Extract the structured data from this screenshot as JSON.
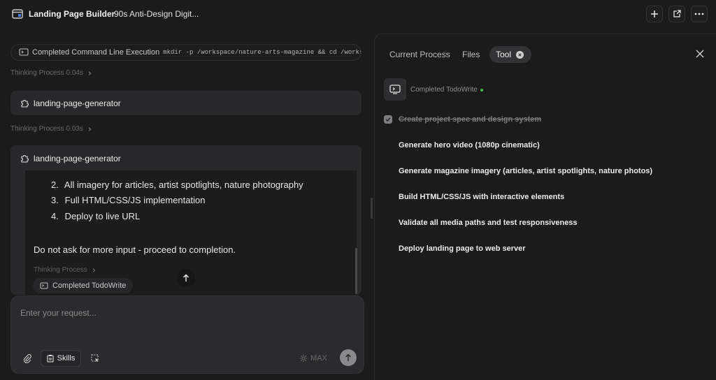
{
  "header": {
    "app_title": "Landing Page Builder",
    "doc_title": "90s Anti-Design Digit..."
  },
  "left": {
    "command_pill": {
      "label": "Completed Command Line Execution",
      "command": "mkdir -p /workspace/nature-arts-magazine && cd /workspace/natu"
    },
    "thinking_1": "Thinking Process 0.04s",
    "generator_1": "landing-page-generator",
    "thinking_2": "Thinking Process 0.03s",
    "generator_2": "landing-page-generator",
    "list_items": [
      {
        "num": "2.",
        "text": "All imagery for articles, artist spotlights, nature photography"
      },
      {
        "num": "3.",
        "text": "Full HTML/CSS/JS implementation"
      },
      {
        "num": "4.",
        "text": "Deploy to live URL"
      }
    ],
    "instruction": "Do not ask for more input - proceed to completion.",
    "thinking_3": "Thinking Process",
    "todo_chip": "Completed TodoWrite"
  },
  "input": {
    "placeholder": "Enter your request...",
    "skills_label": "Skills",
    "max_label": "MAX"
  },
  "panel": {
    "tabs": [
      {
        "label": "Current Process"
      },
      {
        "label": "Files"
      },
      {
        "label": "Tool"
      }
    ],
    "tool_status": "Completed TodoWrite",
    "todos": [
      {
        "text": "Create project spec and design system",
        "done": true
      },
      {
        "text": "Generate hero video (1080p cinematic)",
        "done": false
      },
      {
        "text": "Generate magazine imagery (articles, artist spotlights, nature photos)",
        "done": false
      },
      {
        "text": "Build HTML/CSS/JS with interactive elements",
        "done": false
      },
      {
        "text": "Validate all media paths and test responsiveness",
        "done": false
      },
      {
        "text": "Deploy landing page to web server",
        "done": false
      }
    ]
  },
  "colors": {
    "background": "#1b1b1c",
    "card": "#29292b",
    "status_green": "#3bc24a"
  }
}
